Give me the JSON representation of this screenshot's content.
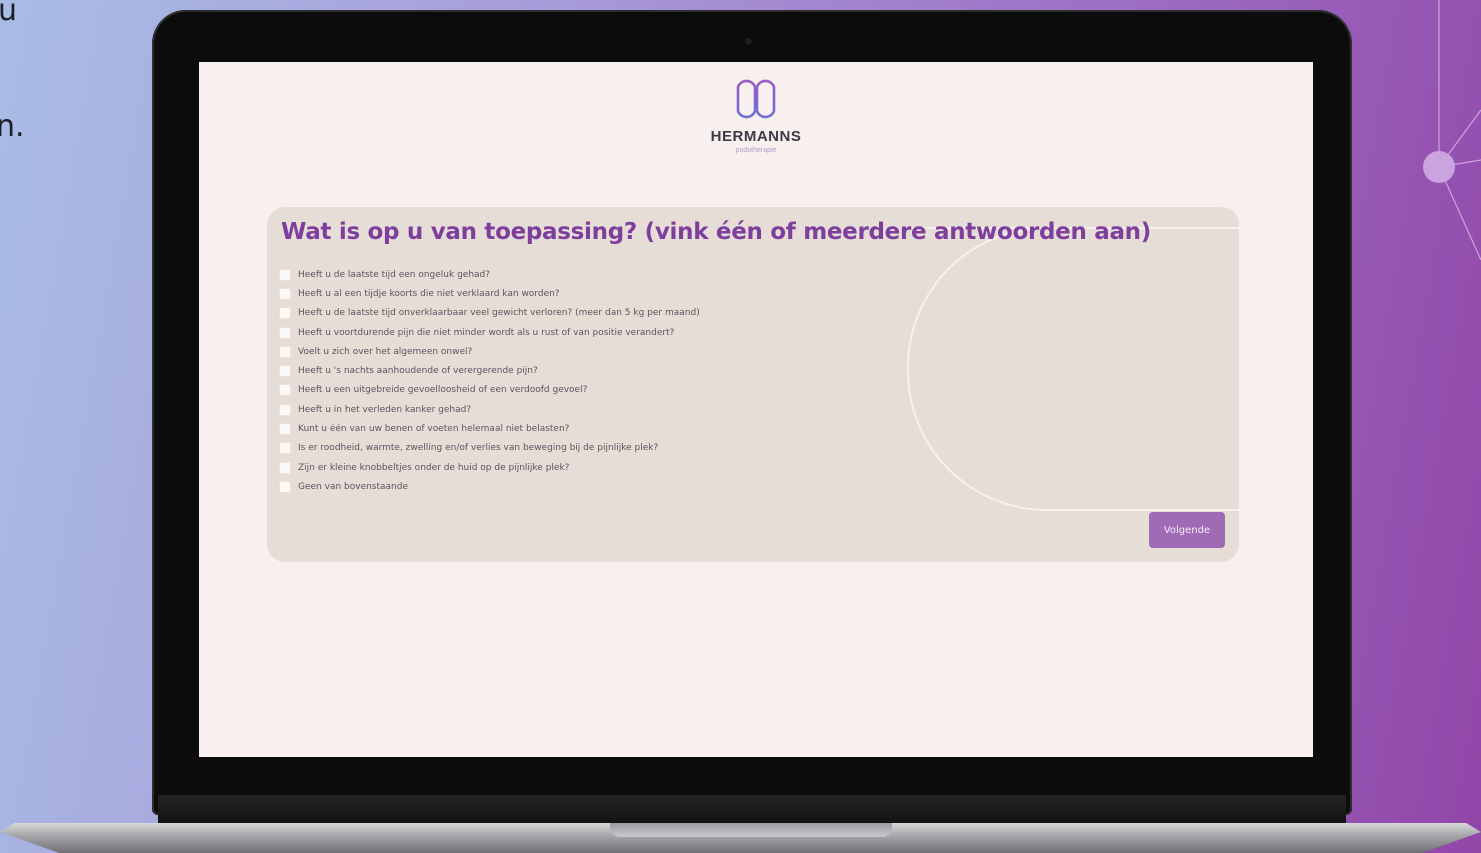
{
  "background_fragments": {
    "line1": "u",
    "line2": "n."
  },
  "colors": {
    "accent_purple": "#7e3e9e",
    "button_purple": "#a06bb5",
    "screen_bg": "#f7f0ee",
    "card_bg": "#e6ddd6"
  },
  "logo": {
    "icon": "hermanns-logo-icon",
    "brand": "HERMANNS",
    "subtitle": "podotherapie"
  },
  "form": {
    "question": "Wat is op u van toepassing? (vink één of meerdere antwoorden aan)",
    "options": [
      "Heeft u de laatste tijd een ongeluk gehad?",
      "Heeft u al een tijdje koorts die niet verklaard kan worden?",
      "Heeft u de laatste tijd onverklaarbaar veel gewicht verloren? (meer dan 5 kg per maand)",
      "Heeft u voortdurende pijn die niet minder wordt als u rust of van positie verandert?",
      "Voelt u zich over het algemeen onwel?",
      "Heeft u 's nachts aanhoudende of verergerende pijn?",
      "Heeft u een uitgebreide gevoelloosheid of een verdoofd gevoel?",
      "Heeft u in het verleden kanker gehad?",
      "Kunt u één van uw benen of voeten helemaal niet belasten?",
      "Is er roodheid, warmte, zwelling en/of verlies van beweging bij de pijnlijke plek?",
      "Zijn er kleine knobbeltjes onder de huid op de pijnlijke plek?",
      "Geen van bovenstaande"
    ],
    "next_button": "Volgende"
  }
}
